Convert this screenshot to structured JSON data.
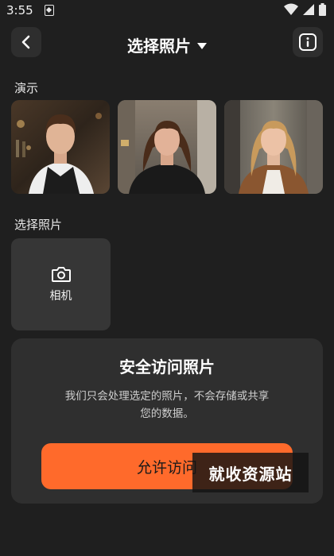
{
  "status": {
    "time": "3:55"
  },
  "header": {
    "title": "选择照片"
  },
  "demo": {
    "label": "演示",
    "photos": [
      "portrait-man-bar",
      "portrait-woman-street",
      "portrait-woman-blonde"
    ]
  },
  "picker": {
    "label": "选择照片",
    "camera_label": "相机"
  },
  "permission": {
    "title": "安全访问照片",
    "description_line1": "我们只会处理选定的照片，不会存储或共享",
    "description_line2": "您的数据。",
    "button_label": "允许访问"
  },
  "watermark": "就收资源站",
  "colors": {
    "background": "#1f1f1f",
    "card": "#2f2f2f",
    "accent": "#ff6a2b"
  }
}
